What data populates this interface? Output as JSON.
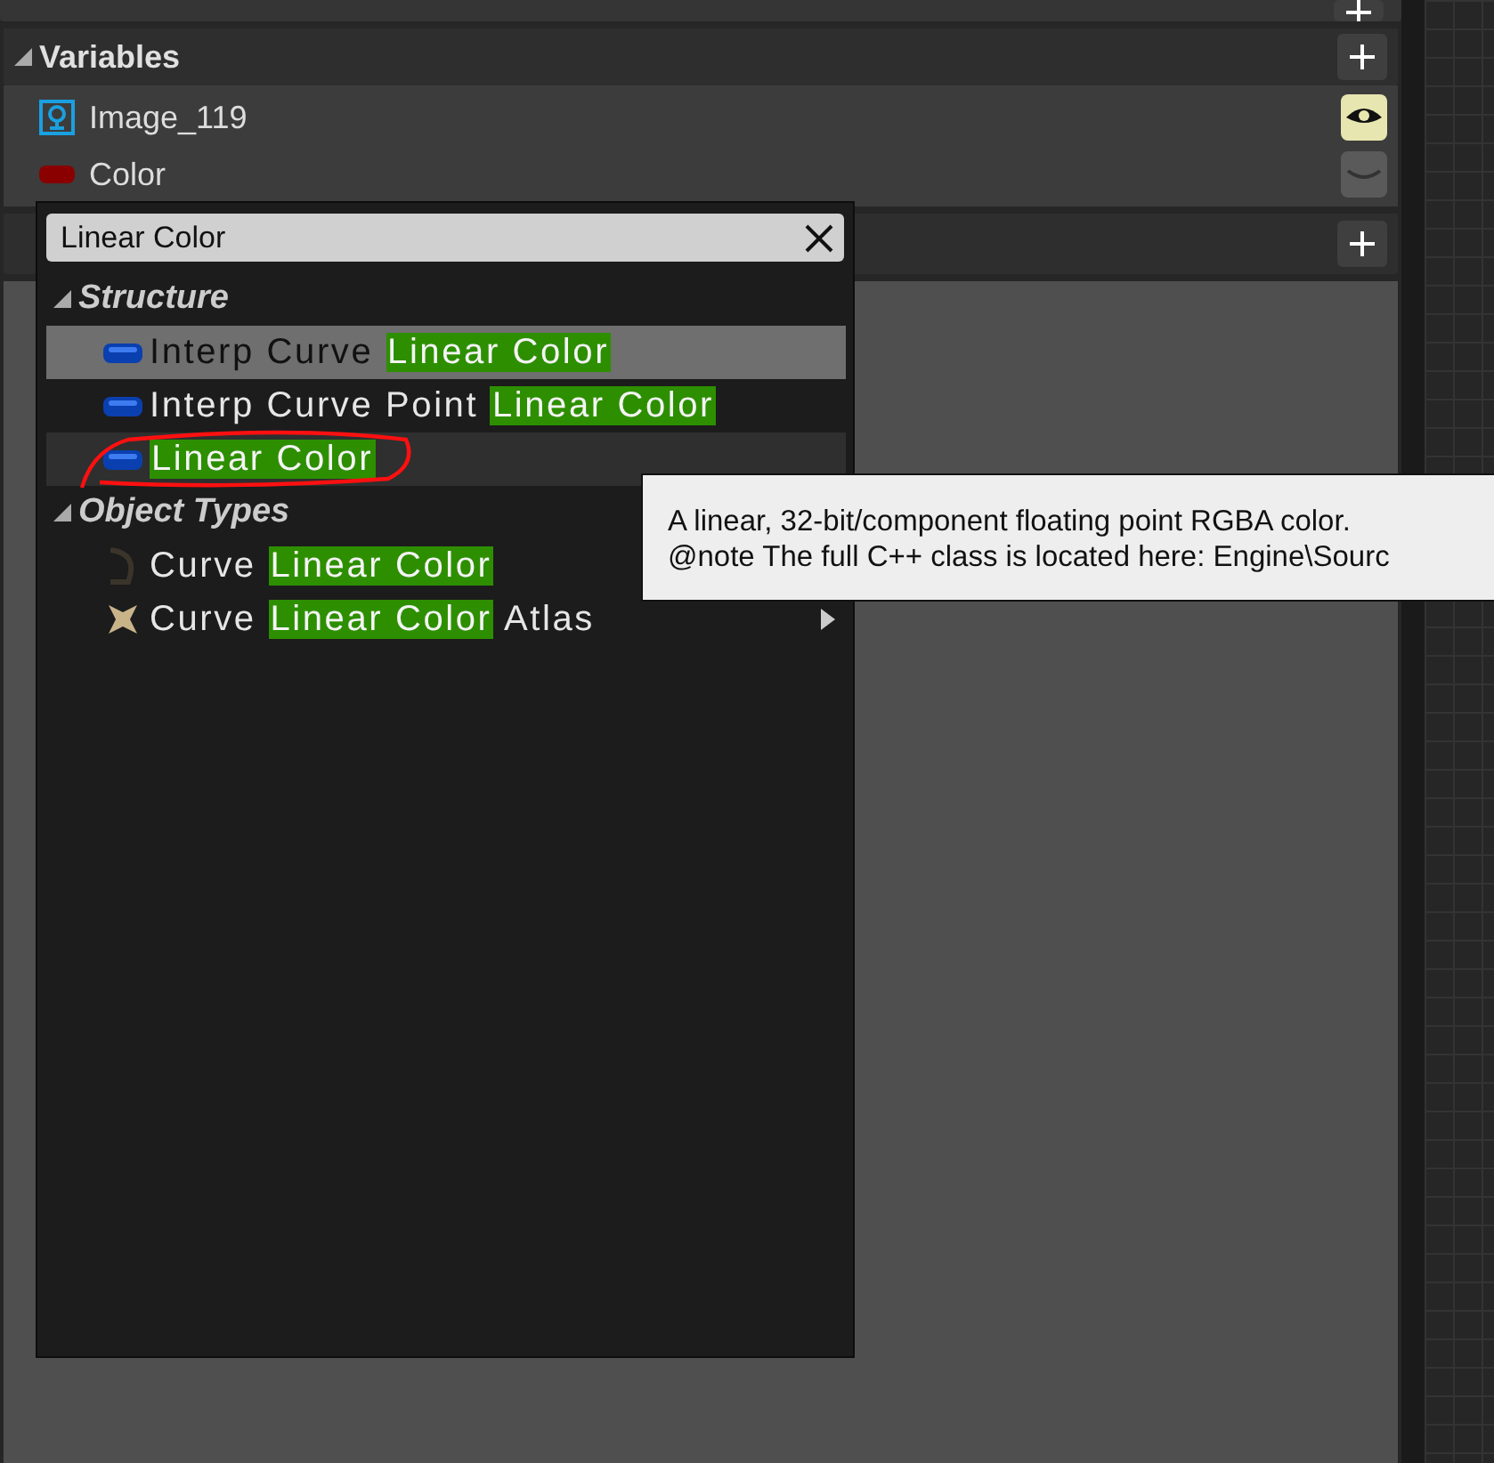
{
  "variables_panel": {
    "title": "Variables",
    "expanded": true,
    "items": [
      {
        "name": "Image_119",
        "kind": "image",
        "visible": true
      },
      {
        "name": "Color",
        "kind": "color",
        "visible": false
      }
    ]
  },
  "type_picker": {
    "search": {
      "value": "Linear Color"
    },
    "categories": [
      {
        "title": "Structure",
        "expanded": true,
        "items": [
          {
            "kind": "struct",
            "before": "Interp Curve ",
            "match": "Linear Color",
            "selected": true,
            "hovered": false,
            "submenu": false,
            "circled": false
          },
          {
            "kind": "struct",
            "before": "Interp Curve Point ",
            "match": "Linear Color",
            "selected": false,
            "hovered": false,
            "submenu": false,
            "circled": false
          },
          {
            "kind": "struct",
            "match": "Linear Color",
            "selected": false,
            "hovered": true,
            "submenu": false,
            "circled": true
          }
        ]
      },
      {
        "title": "Object Types",
        "expanded": true,
        "items": [
          {
            "kind": "curve",
            "before": "Curve ",
            "match": "Linear Color",
            "selected": false,
            "hovered": false,
            "circled": false
          },
          {
            "kind": "atlas",
            "before": "Curve ",
            "match": "Linear Color",
            "after": " Atlas",
            "selected": false,
            "hovered": false,
            "submenu": true,
            "circled": false
          }
        ]
      }
    ]
  },
  "tooltip": {
    "lines": [
      "A linear, 32-bit/component floating point RGBA color.",
      "@note The full C++ class is located here: Engine\\Sourc"
    ]
  }
}
